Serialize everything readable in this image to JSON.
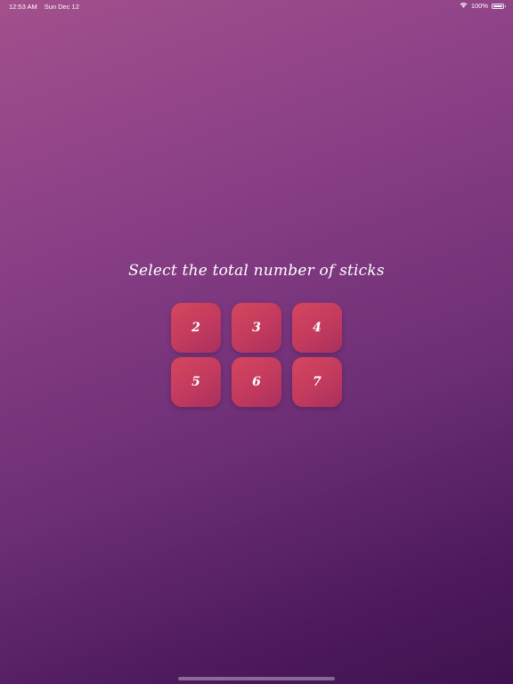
{
  "status_bar": {
    "time": "12:53 AM",
    "date": "Sun Dec 12",
    "battery": "100%",
    "battery_level": 1.0
  },
  "screen": {
    "title": "Select the total number of sticks"
  },
  "options": [
    {
      "label": "2"
    },
    {
      "label": "3"
    },
    {
      "label": "4"
    },
    {
      "label": "5"
    },
    {
      "label": "6"
    },
    {
      "label": "7"
    }
  ]
}
